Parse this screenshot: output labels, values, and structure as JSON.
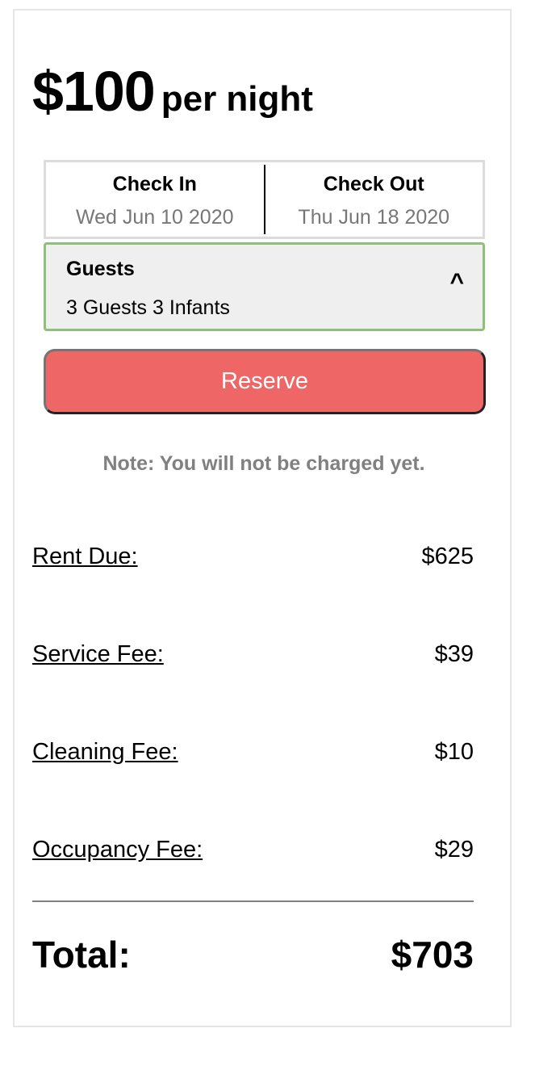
{
  "pricing": {
    "amount": "$100",
    "suffix": "per night"
  },
  "dates": {
    "check_in": {
      "label": "Check In",
      "value": "Wed Jun 10 2020"
    },
    "check_out": {
      "label": "Check Out",
      "value": "Thu Jun 18 2020"
    }
  },
  "guests": {
    "label": "Guests",
    "value": "3 Guests 3 Infants",
    "toggle_glyph": "^"
  },
  "reserve": {
    "label": "Reserve"
  },
  "note": "Note: You will not be charged yet.",
  "fees": [
    {
      "label": "Rent Due:",
      "amount": "$625"
    },
    {
      "label": "Service Fee:",
      "amount": "$39"
    },
    {
      "label": "Cleaning Fee:",
      "amount": "$10"
    },
    {
      "label": "Occupancy Fee:",
      "amount": "$29"
    }
  ],
  "total": {
    "label": "Total:",
    "amount": "$703"
  },
  "colors": {
    "reserve_bg": "#ef6666",
    "guests_border": "#8dc07b",
    "note_text": "#808080"
  }
}
